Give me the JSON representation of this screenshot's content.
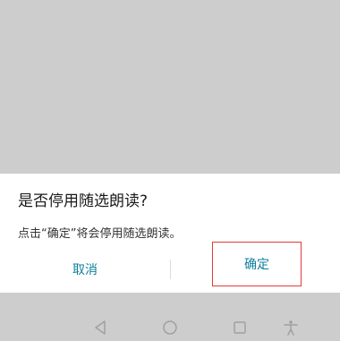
{
  "dialog": {
    "title": "是否停用随选朗读?",
    "message": "点击“确定”将会停用随选朗读。",
    "cancel_label": "取消",
    "confirm_label": "确定"
  },
  "nav_bar": {
    "icons": [
      "back-triangle-icon",
      "home-circle-icon",
      "recent-square-icon",
      "accessibility-icon"
    ]
  },
  "colors": {
    "backdrop": "#cdcdcd",
    "dialog_bg": "#ffffff",
    "button_text": "#0f7f9c",
    "highlight_border": "#e23a3a",
    "nav_icon": "#a0a0a0"
  }
}
